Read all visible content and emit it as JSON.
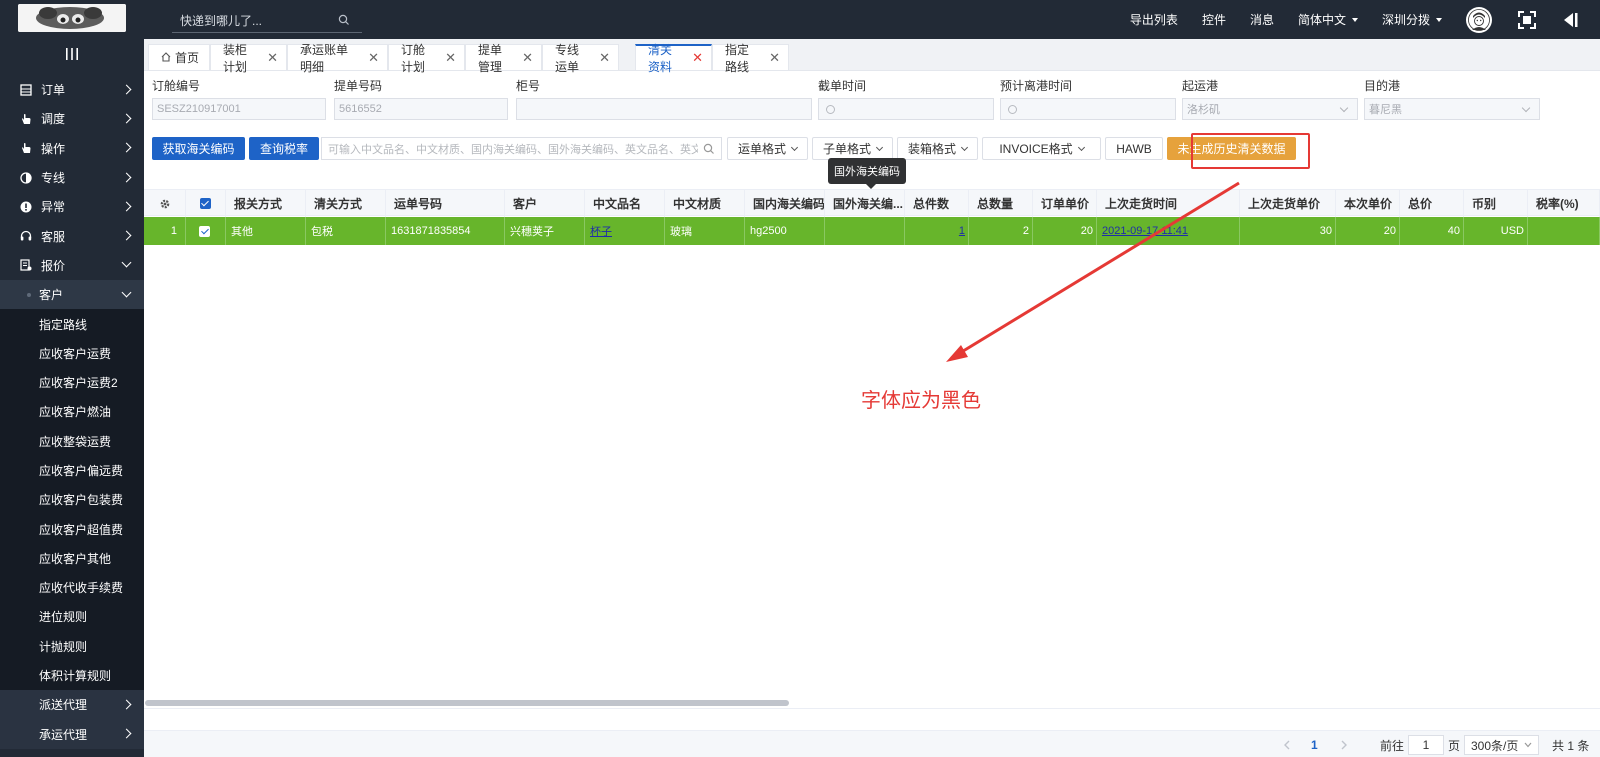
{
  "topbar": {
    "search_placeholder": "快递到哪儿了...",
    "items": [
      "导出列表",
      "控件",
      "消息"
    ],
    "language": "简体中文",
    "branch": "深圳分拨"
  },
  "sidebar": {
    "items": [
      {
        "label": "订单",
        "icon": "order-icon"
      },
      {
        "label": "调度",
        "icon": "hand-icon"
      },
      {
        "label": "操作",
        "icon": "hand-icon"
      },
      {
        "label": "专线",
        "icon": "half-circle-icon"
      },
      {
        "label": "异常",
        "icon": "alert-icon"
      },
      {
        "label": "客服",
        "icon": "headset-icon"
      },
      {
        "label": "报价",
        "icon": "quote-icon"
      }
    ],
    "group": "客户",
    "sub_items": [
      "指定路线",
      "应收客户运费",
      "应收客户运费2",
      "应收客户燃油",
      "应收整袋运费",
      "应收客户偏远费",
      "应收客户包装费",
      "应收客户超值费",
      "应收客户其他",
      "应收代收手续费",
      "进位规则",
      "计抛规则",
      "体积计算规则"
    ],
    "bottom_items": [
      "派送代理",
      "承运代理"
    ]
  },
  "tabs": [
    {
      "label": "首页"
    },
    {
      "label": "装柜计划"
    },
    {
      "label": "承运账单明细"
    },
    {
      "label": "订舱计划"
    },
    {
      "label": "提单管理"
    },
    {
      "label": "专线运单"
    },
    {
      "label": "清关资料",
      "active": true
    },
    {
      "label": "指定路线"
    }
  ],
  "form": {
    "fields": [
      {
        "label": "订舱编号",
        "value": "SESZ210917001"
      },
      {
        "label": "提单号码",
        "value": "5616552"
      },
      {
        "label": "柜号",
        "value": ""
      },
      {
        "label": "截单时间",
        "value": ""
      },
      {
        "label": "预计离港时间",
        "value": ""
      },
      {
        "label": "起运港",
        "value": "洛杉矶"
      },
      {
        "label": "目的港",
        "value": "暮尼黑"
      }
    ]
  },
  "toolbar": {
    "get_code": "获取海关编码",
    "query_tax": "查询税率",
    "keyword_placeholder": "可输入中文品名、中文材质、国内海关编码、国外海关编码、英文品名、英文材质",
    "dropdowns": [
      "运单格式",
      "子单格式",
      "装箱格式",
      "INVOICE格式"
    ],
    "hawb": "HAWB",
    "generate_history": "未生成历史清关数据",
    "tooltip": "国外海关编码"
  },
  "table": {
    "headers": [
      "报关方式",
      "清关方式",
      "运单号码",
      "客户",
      "中文品名",
      "中文材质",
      "国内海关编码",
      "国外海关编...",
      "总件数",
      "总数量",
      "订单单价",
      "上次走货时间",
      "上次走货单价",
      "本次单价",
      "总价",
      "币别",
      "税率(%)"
    ],
    "rows": [
      {
        "index": "1",
        "cells": [
          "其他",
          "包税",
          "1631871835854",
          "兴穗荚子",
          "杯子",
          "玻璃",
          "hg2500",
          "",
          "1",
          "2",
          "20",
          "2021-09-17 11:41",
          "30",
          "20",
          "40",
          "USD",
          ""
        ]
      }
    ]
  },
  "pager": {
    "current": "1",
    "goto_label": "前往",
    "goto_value": "1",
    "page_unit": "页",
    "page_size": "300条/页",
    "total": "共 1 条"
  },
  "annotation": {
    "text": "字体应为黑色"
  },
  "colors": {
    "nav_bg": "#222a36",
    "primary": "#1e63c7",
    "row_highlight": "#67b52b",
    "warning": "#e6a23c",
    "annotation": "#e53935"
  }
}
